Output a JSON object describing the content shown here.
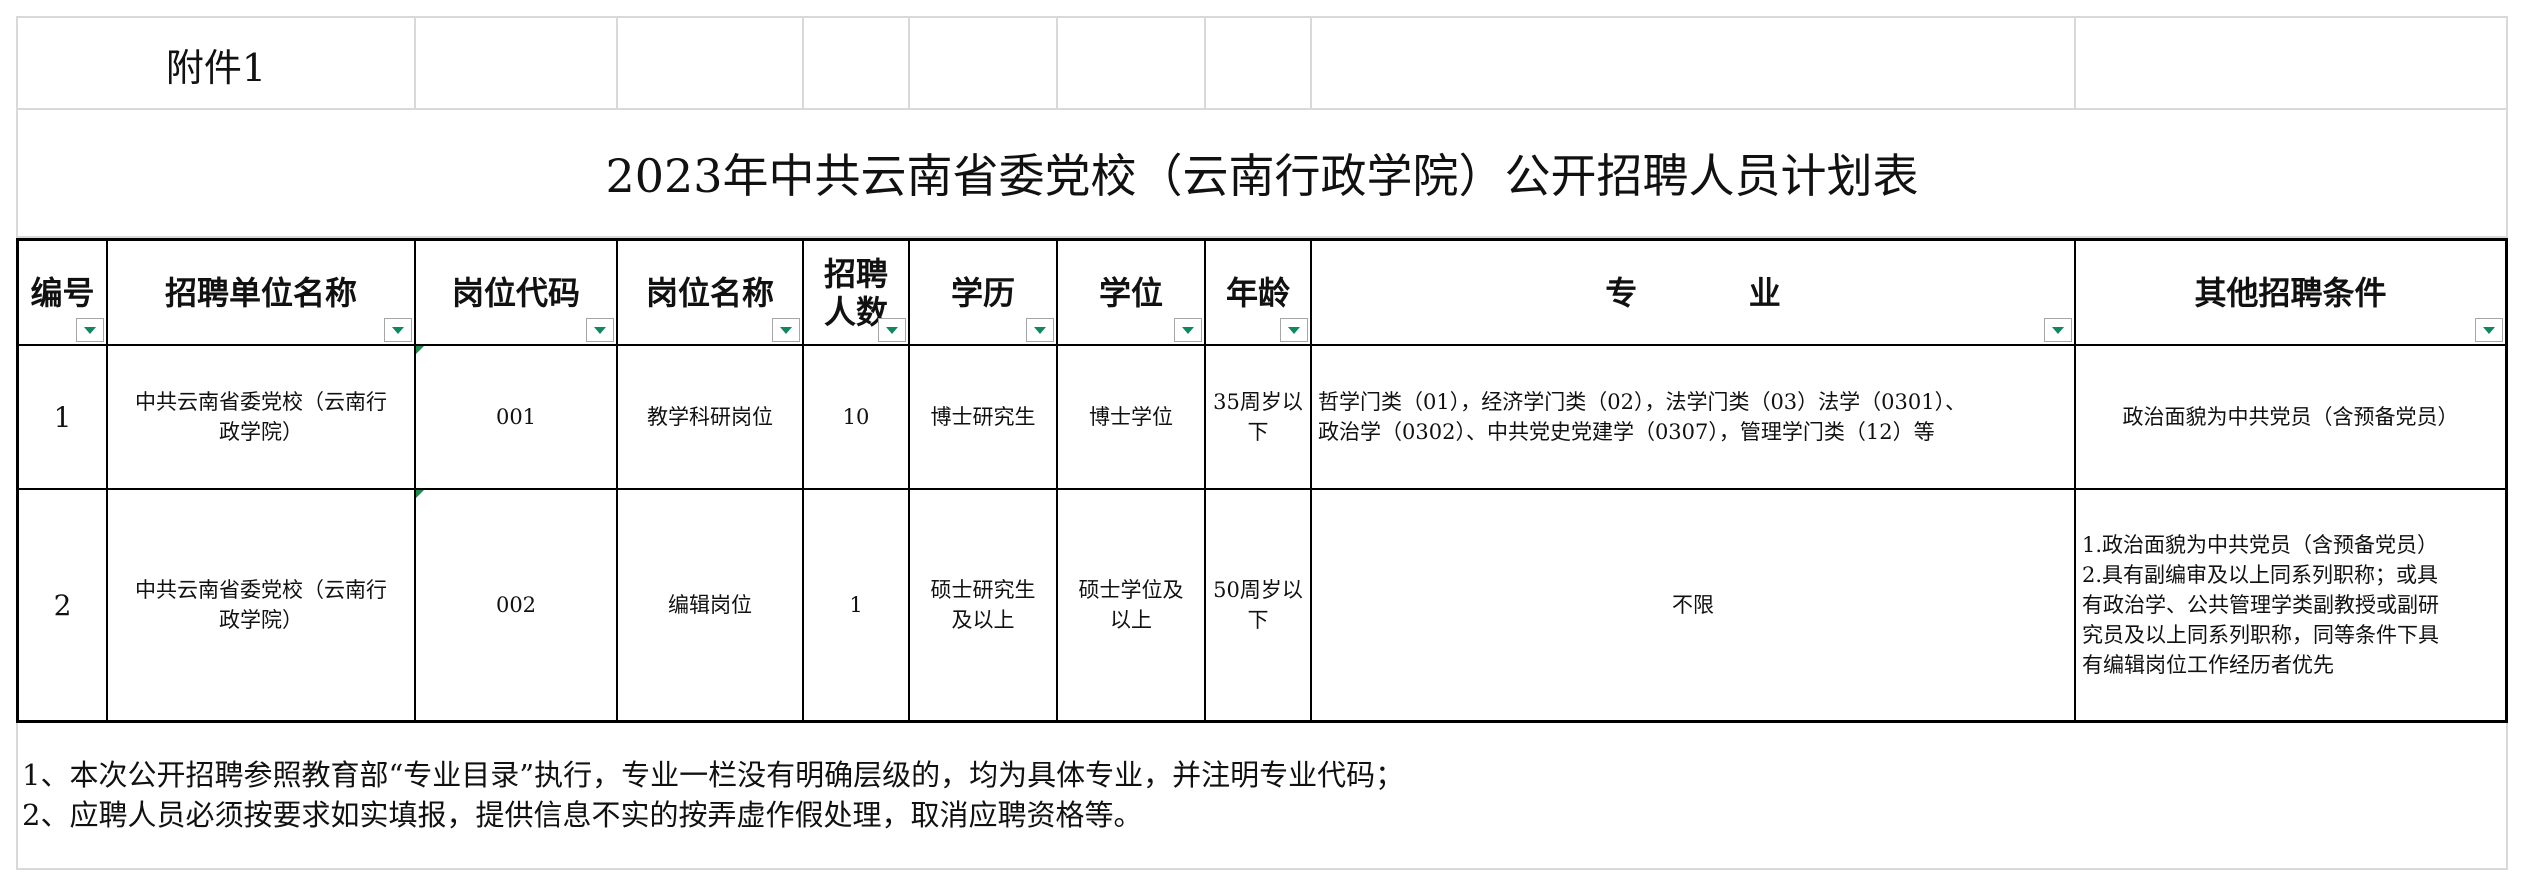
{
  "attachment_label": "附件1",
  "title": "2023年中共云南省委党校（云南行政学院）公开招聘人员计划表",
  "headers": {
    "no": "编号",
    "unit": "招聘单位名称",
    "code": "岗位代码",
    "name": "岗位名称",
    "count_line1": "招聘",
    "count_line2": "人数",
    "education": "学历",
    "degree": "学位",
    "age": "年龄",
    "major": "专          业",
    "other": "其他招聘条件"
  },
  "rows": [
    {
      "no": "1",
      "unit_line1": "中共云南省委党校（云南行",
      "unit_line2": "政学院）",
      "code": "001",
      "name": "教学科研岗位",
      "count": "10",
      "education": "博士研究生",
      "degree": "博士学位",
      "age_line1": "35周岁以",
      "age_line2": "下",
      "major_line1": "哲学门类（01），经济学门类（02），法学门类（03）法学（0301）、",
      "major_line2": "政治学（0302）、中共党史党建学（0307），管理学门类（12）等",
      "other": "政治面貌为中共党员（含预备党员）"
    },
    {
      "no": "2",
      "unit_line1": "中共云南省委党校（云南行",
      "unit_line2": "政学院）",
      "code": "002",
      "name": "编辑岗位",
      "count": "1",
      "education_line1": "硕士研究生",
      "education_line2": "及以上",
      "degree_line1": "硕士学位及",
      "degree_line2": "以上",
      "age_line1": "50周岁以",
      "age_line2": "下",
      "major": "不限",
      "other_lines": [
        "1.政治面貌为中共党员（含预备党员）",
        "2.具有副编审及以上同系列职称；或具",
        "有政治学、公共管理学类副教授或副研",
        "究员及以上同系列职称，同等条件下具",
        "有编辑岗位工作经历者优先"
      ]
    }
  ],
  "notes": [
    "1、本次公开招聘参照教育部“专业目录”执行，专业一栏没有明确层级的，均为具体专业，并注明专业代码；",
    "2、应聘人员必须按要求如实填报，提供信息不实的按弄虚作假处理，取消应聘资格等。"
  ],
  "colors": {
    "grid": "#d9d9d9",
    "border": "#000000",
    "dropdown_arrow": "#0d8a5b"
  },
  "icons": [
    "dropdown-arrow-icon",
    "comment-indicator-icon"
  ]
}
